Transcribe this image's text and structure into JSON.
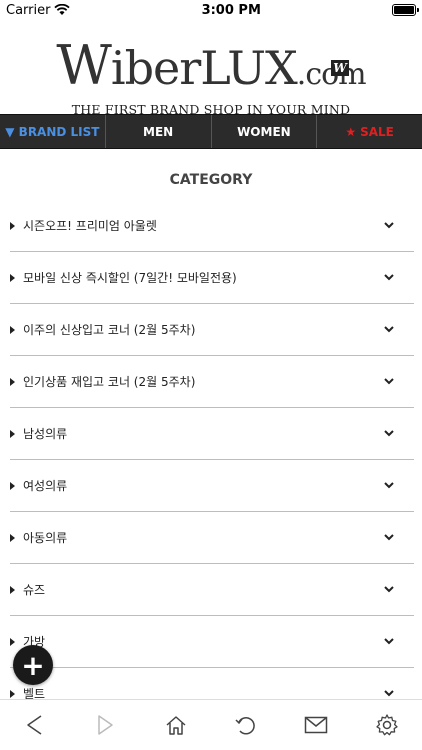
{
  "status": {
    "carrier": "Carrier",
    "time": "3:00 PM"
  },
  "logo": {
    "w": "W",
    "rest": "iberLUX",
    "com": ".com",
    "badge": "W",
    "tagline": "THE FIRST BRAND SHOP IN YOUR MIND"
  },
  "nav": {
    "brand_list": "▼ BRAND LIST",
    "men": "MEN",
    "women": "WOMEN",
    "sale_star": "★",
    "sale": "SALE"
  },
  "category_title": "CATEGORY",
  "categories": [
    {
      "label": "시즌오프! 프리미엄 아울렛"
    },
    {
      "label": "모바일 신상 즉시할인 (7일간! 모바일전용)"
    },
    {
      "label": "이주의 신상입고 코너 (2월 5주차)"
    },
    {
      "label": "인기상품 재입고 코너 (2월 5주차)"
    },
    {
      "label": "남성의류"
    },
    {
      "label": "여성의류"
    },
    {
      "label": "아동의류"
    },
    {
      "label": "슈즈"
    },
    {
      "label": "가방"
    },
    {
      "label": "벨트"
    }
  ],
  "fab": {
    "label": "+"
  },
  "colors": {
    "nav_bg": "#2b2b2b",
    "brand": "#4a90e2",
    "sale": "#e02020"
  }
}
